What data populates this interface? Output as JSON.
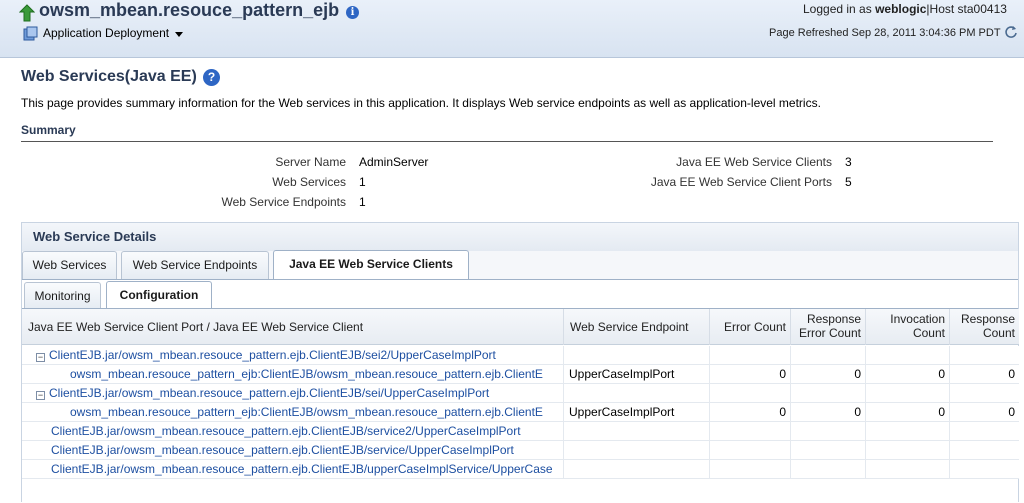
{
  "header": {
    "app_title": "owsm_mbean.resouce_pattern_ejb",
    "deployment_menu": "Application Deployment",
    "logged_in_prefix": "Logged in as",
    "user": "weblogic",
    "host_text": "|Host sta00413",
    "page_refreshed": "Page Refreshed Sep 28, 2011 3:04:36 PM PDT"
  },
  "page": {
    "title": "Web Services(Java EE)",
    "help": "?",
    "description": "This page provides summary information for the Web services in this application. It displays Web service endpoints as well as application-level metrics."
  },
  "summary": {
    "title": "Summary",
    "server_name_label": "Server Name",
    "server_name_value": "AdminServer",
    "web_services_label": "Web Services",
    "web_services_value": "1",
    "endpoints_label": "Web Service Endpoints",
    "endpoints_value": "1",
    "clients_label": "Java EE Web Service Clients",
    "clients_value": "3",
    "client_ports_label": "Java EE Web Service Client Ports",
    "client_ports_value": "5"
  },
  "details": {
    "title": "Web Service Details",
    "tabs": [
      "Web Services",
      "Web Service Endpoints",
      "Java EE Web Service Clients"
    ],
    "active_tab": "Java EE Web Service Clients",
    "subtabs": [
      "Monitoring",
      "Configuration"
    ],
    "active_subtab": "Configuration"
  },
  "table": {
    "columns": [
      "Java EE Web Service Client Port / Java EE Web Service Client",
      "Web Service Endpoint",
      "Error Count",
      "Response Error Count",
      "Invocation Count",
      "Response Count"
    ],
    "rows": [
      {
        "name": "ClientEJB.jar/owsm_mbean.resouce_pattern.ejb.ClientEJB/sei2/UpperCaseImplPort",
        "expander": "−",
        "endpoint": "",
        "error": "",
        "resp_error": "",
        "invocation": "",
        "response": ""
      },
      {
        "name": "owsm_mbean.resouce_pattern_ejb:ClientEJB/owsm_mbean.resouce_pattern.ejb.ClientE",
        "expander": "",
        "endpoint": "UpperCaseImplPort",
        "error": "0",
        "resp_error": "0",
        "invocation": "0",
        "response": "0"
      },
      {
        "name": "ClientEJB.jar/owsm_mbean.resouce_pattern.ejb.ClientEJB/sei/UpperCaseImplPort",
        "expander": "−",
        "endpoint": "",
        "error": "",
        "resp_error": "",
        "invocation": "",
        "response": ""
      },
      {
        "name": "owsm_mbean.resouce_pattern_ejb:ClientEJB/owsm_mbean.resouce_pattern.ejb.ClientE",
        "expander": "",
        "endpoint": "UpperCaseImplPort",
        "error": "0",
        "resp_error": "0",
        "invocation": "0",
        "response": "0"
      },
      {
        "name": "ClientEJB.jar/owsm_mbean.resouce_pattern.ejb.ClientEJB/service2/UpperCaseImplPort",
        "expander": "",
        "endpoint": "",
        "error": "",
        "resp_error": "",
        "invocation": "",
        "response": ""
      },
      {
        "name": "ClientEJB.jar/owsm_mbean.resouce_pattern.ejb.ClientEJB/service/UpperCaseImplPort",
        "expander": "",
        "endpoint": "",
        "error": "",
        "resp_error": "",
        "invocation": "",
        "response": ""
      },
      {
        "name": "ClientEJB.jar/owsm_mbean.resouce_pattern.ejb.ClientEJB/upperCaseImplService/UpperCase",
        "expander": "",
        "endpoint": "",
        "error": "",
        "resp_error": "",
        "invocation": "",
        "response": ""
      }
    ]
  }
}
